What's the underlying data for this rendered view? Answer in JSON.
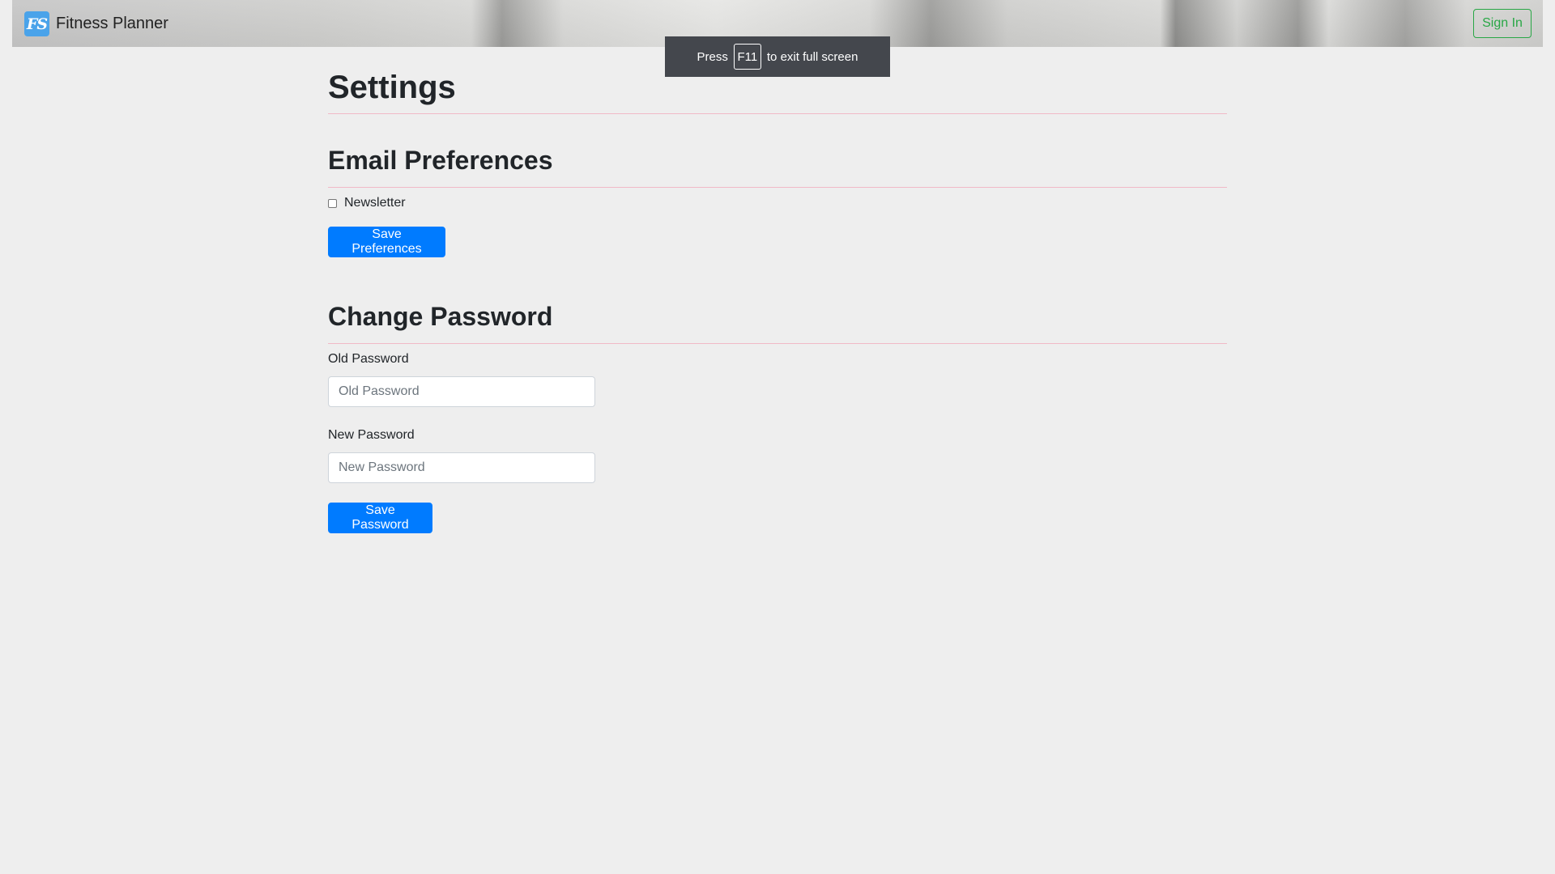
{
  "navbar": {
    "logo_text": "FS",
    "brand_name": "Fitness Planner",
    "signin_label": "Sign In"
  },
  "fullscreen_notice": {
    "prefix": "Press",
    "key": "F11",
    "suffix": "to exit full screen"
  },
  "page": {
    "title": "Settings"
  },
  "email_preferences": {
    "title": "Email Preferences",
    "newsletter_label": "Newsletter",
    "newsletter_checked": false,
    "save_label": "Save Preferences"
  },
  "change_password": {
    "title": "Change Password",
    "old_label": "Old Password",
    "old_placeholder": "Old Password",
    "new_label": "New Password",
    "new_placeholder": "New Password",
    "save_label": "Save Password"
  },
  "colors": {
    "primary": "#007bff",
    "success": "#28a745",
    "rule": "#f1b9c7",
    "background": "#eeeeee"
  }
}
